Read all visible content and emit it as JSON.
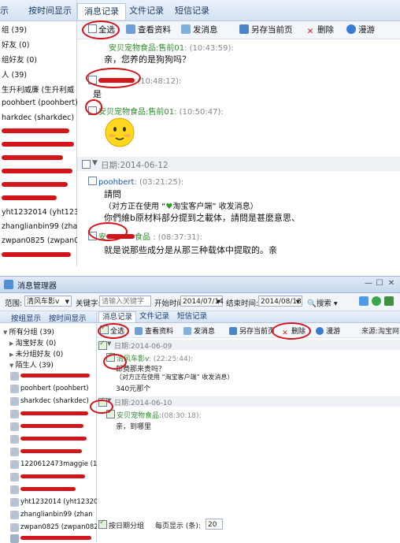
{
  "top": {
    "sidebar": {
      "tab_partial": "示",
      "tab_by_time": "按时间显示",
      "items": [
        "组 (39)",
        "好友 (0)",
        "组好友 (0)",
        "人 (39)",
        "生升利威廉 (生升利威",
        "poohbert (poohbert)",
        "harkdec (sharkdec)",
        "yht1232014 (yht12320",
        "zhanglianbin99 (zhan",
        "zwpan0825 (zwpan0825"
      ]
    },
    "tabs": [
      "消息记录",
      "文件记录",
      "短信记录"
    ],
    "toolbar": {
      "select_all": "全选",
      "view_profile": "查看资料",
      "send_message": "发消息",
      "save_as_page": "另存当前页",
      "delete": "删除",
      "roam": "漫游"
    },
    "messages": [
      {
        "sender": "安贝宠物食品:售前01",
        "time": ": (10:43:59):",
        "text": "亲，您养的是狗狗吗？"
      },
      {
        "sender": "",
        "time": "(10:48:12):",
        "text": "是"
      },
      {
        "sender": "安贝宠物食品:售前01",
        "time": ": (10:50:47):",
        "text": ""
      },
      {
        "sender": "poohbert",
        "time": ": (03:21:25):",
        "text": "請問"
      },
      {
        "sender": "",
        "time": ": (08:37:31):",
        "text": "就是说那些成分是从那三种载体中提取的。亲"
      }
    ],
    "date_label": "日期:2014-06-12",
    "client_note_prefix": "（对方正在使用 “",
    "client_note_app": "淘宝客户端",
    "client_note_suffix": "” 收发消息）",
    "poohbert_line2": "你們維b原材料部分提到之載体，請問是甚麼意思、",
    "sender_partial": "安",
    "sender_partial_suffix": "食品"
  },
  "bottom": {
    "title": "消息管理器",
    "filter": {
      "range_label": "范围:",
      "range_value": "清风车影v",
      "keyword_label": "关键字:",
      "keyword_placeholder": "请输入关键字",
      "start_label": "开始时间:",
      "start_value": "2014/07/14",
      "end_label": "结束时间:",
      "end_value": "2014/08/13",
      "search_button": "搜索"
    },
    "sidebar": {
      "tab_group": "按组显示",
      "tab_time": "按时间显示",
      "tree": [
        "所有分组 (39)",
        "淘宝好友 (0)",
        "未分组好友 (0)",
        "陌生人 (39)"
      ],
      "contacts": [
        "poohbert (poohbert)",
        "sharkdec (sharkdec)",
        "1220612473maggie (12",
        "yht1232014 (yht12320",
        "zhanglianbin99 (zhan",
        "zwpan0825 (zwpan0825"
      ]
    },
    "tabs": [
      "消息记录",
      "文件记录",
      "短信记录"
    ],
    "toolbar": {
      "select_all": "全选",
      "view_profile": "查看资料",
      "send_message": "发消息",
      "save_as_page": "另存当前页",
      "delete": "删除",
      "roam": "漫游",
      "source": "来源:淘宝网"
    },
    "date_labels": [
      "日期:2014-06-09",
      "日期:2014-06-10"
    ],
    "messages": [
      {
        "sender": "清风车影v",
        "time": ": (22:25:44):",
        "lines": [
          "邮费那来贵吗？",
          "（对方正在使用 “淘宝客户端” 收发消息）",
          "340元那个"
        ]
      },
      {
        "sender": "安贝宠物食品:",
        "time": "(08:30:18):",
        "lines": [
          "亲，到哪里"
        ]
      }
    ],
    "footer": {
      "by_date_group": "按日期分组",
      "per_page_label": "每页显示 (条):",
      "per_page_value": "20"
    }
  },
  "colors": {
    "annotation_red": "#d2141b",
    "sender_green": "#2e8b2e",
    "header_blue": "#d5e2f3"
  }
}
